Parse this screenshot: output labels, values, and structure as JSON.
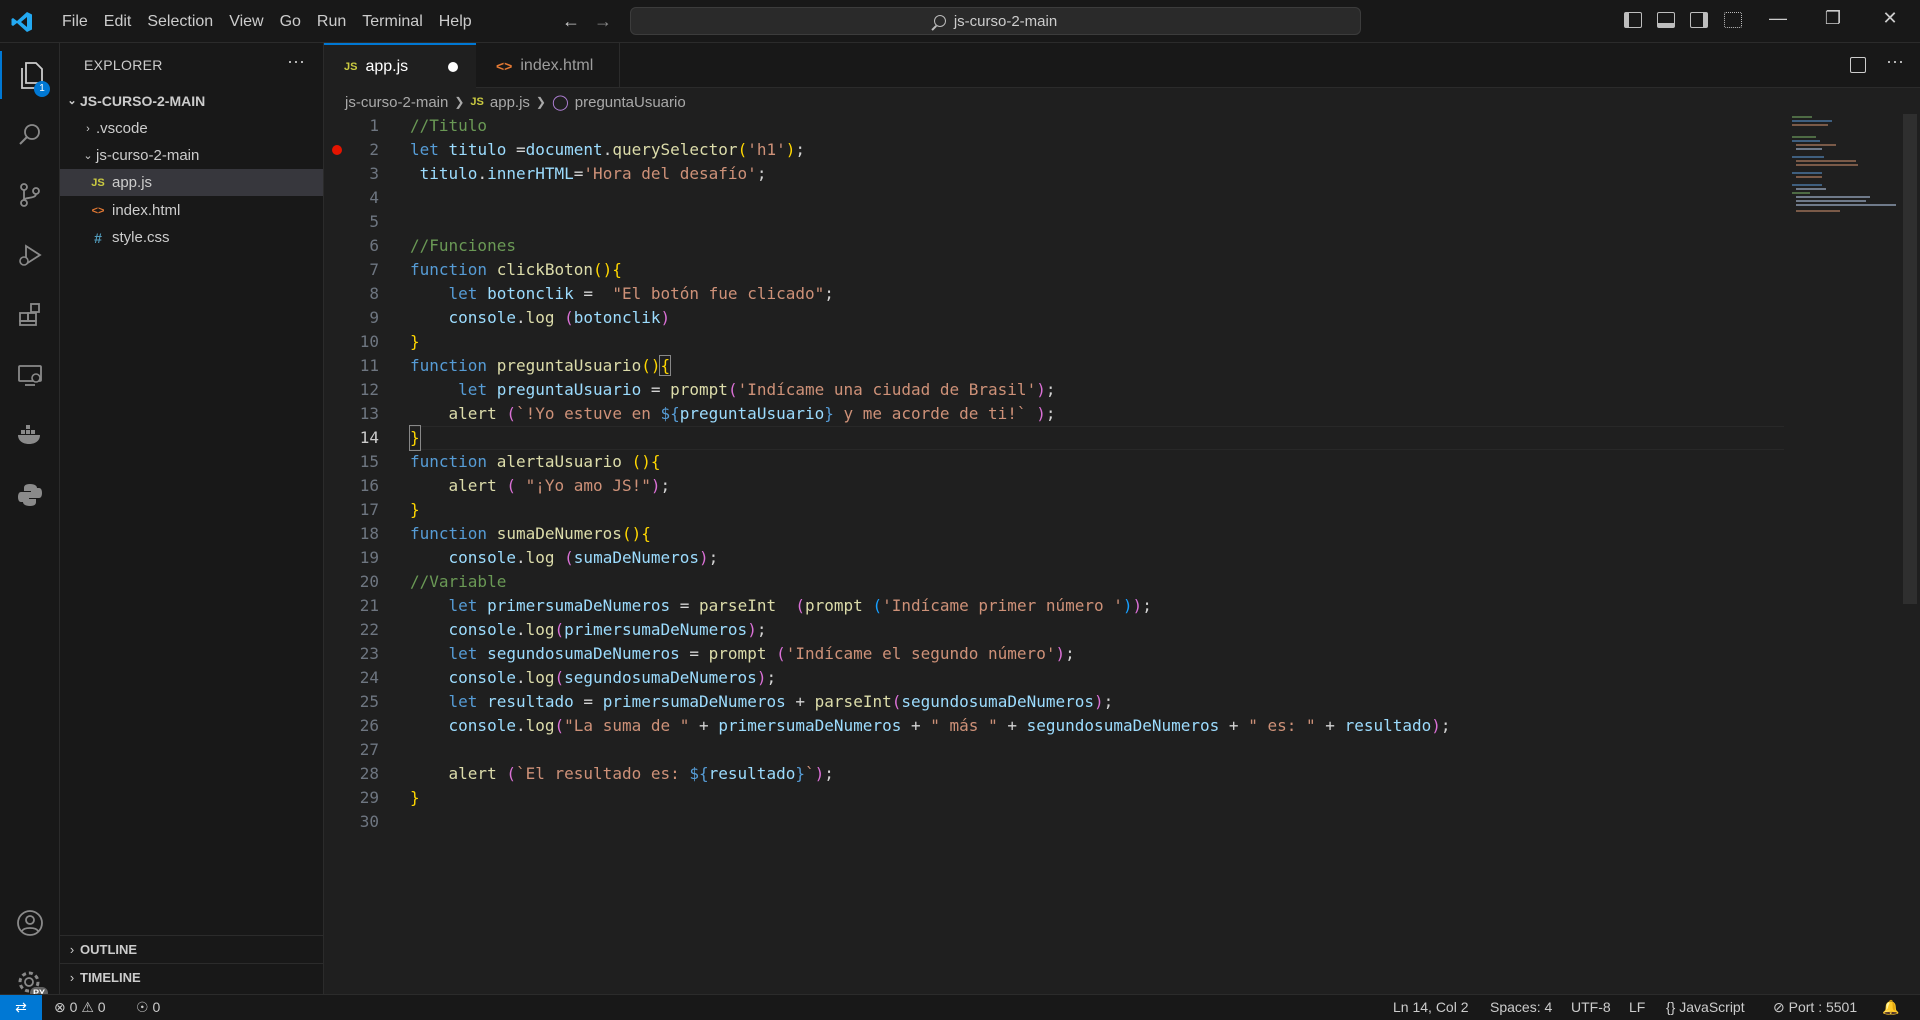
{
  "titlebar": {
    "menu": [
      "File",
      "Edit",
      "Selection",
      "View",
      "Go",
      "Run",
      "Terminal",
      "Help"
    ],
    "search": "js-curso-2-main"
  },
  "activitybar": {
    "explorer_badge": "1",
    "accounts_badge": "PY"
  },
  "explorer": {
    "header": "EXPLORER",
    "root": "JS-CURSO-2-MAIN",
    "items": [
      {
        "label": ".vscode"
      },
      {
        "label": "js-curso-2-main"
      },
      {
        "label": "app.js",
        "icon": "JS"
      },
      {
        "label": "index.html",
        "icon": "<>"
      },
      {
        "label": "style.css",
        "icon": "#"
      }
    ],
    "outline": "OUTLINE",
    "timeline": "TIMELINE"
  },
  "tabs": [
    {
      "label": "app.js",
      "icon": "JS"
    },
    {
      "label": "index.html",
      "icon": "<>"
    }
  ],
  "breadcrumb": [
    "js-curso-2-main",
    "app.js",
    "preguntaUsuario"
  ],
  "editor": {
    "line_numbers": [
      "1",
      "2",
      "3",
      "4",
      "5",
      "6",
      "7",
      "8",
      "9",
      "10",
      "11",
      "12",
      "13",
      "14",
      "15",
      "16",
      "17",
      "18",
      "19",
      "20",
      "21",
      "22",
      "23",
      "24",
      "25",
      "26",
      "27",
      "28",
      "29",
      "30"
    ],
    "current_line": "14",
    "code": [
      "//Titulo",
      "let titulo =document.querySelector('h1');",
      " titulo.innerHTML='Hora del desafío';",
      "",
      "",
      "//Funciones",
      "function clickBoton(){",
      "    let botonclik =  \"El botón fue clicado\";",
      "    console.log (botonclik)",
      "}",
      "function preguntaUsuario(){",
      "     let preguntaUsuario = prompt('Indícame una ciudad de Brasil');",
      "    alert (`!Yo estuve en ${preguntaUsuario} y me acorde de ti!` );",
      "}",
      "function alertaUsuario (){",
      "    alert ( \"¡Yo amo JS!\");",
      "}",
      "function sumaDeNumeros(){",
      "    console.log (sumaDeNumeros);",
      "//Variable",
      "    let primersumaDeNumeros = parseInt  (prompt ('Indícame primer número '));",
      "    console.log(primersumaDeNumeros);",
      "    let segundosumaDeNumeros = prompt ('Indícame el segundo número');",
      "    console.log(segundosumaDeNumeros);",
      "    let resultado = primersumaDeNumeros + parseInt(segundosumaDeNumeros);",
      "    console.log(\"La suma de \" + primersumaDeNumeros + \" más \" + segundosumaDeNumeros + \" es: \" + resultado);",
      "",
      "    alert (`El resultado es: ${resultado}`);",
      "}",
      ""
    ]
  },
  "statusbar": {
    "errors": "0",
    "warnings": "0",
    "ports": "0",
    "cursor": "Ln 14, Col 2",
    "spaces": "Spaces: 4",
    "encoding": "UTF-8",
    "eol": "LF",
    "language": "JavaScript",
    "port": "Port : 5501"
  }
}
